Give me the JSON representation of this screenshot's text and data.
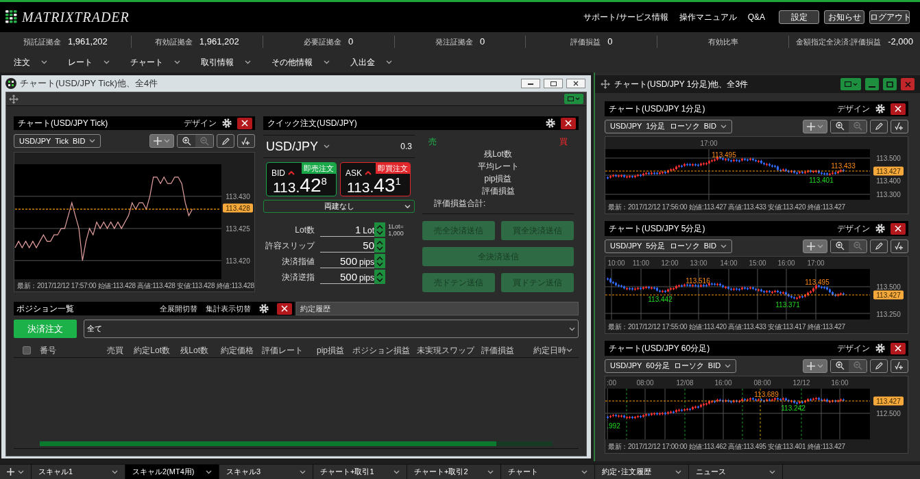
{
  "header": {
    "logo": "MATRIXTRADER",
    "links": [
      "サポート/サービス情報",
      "操作マニュアル",
      "Q&A"
    ],
    "buttons": [
      "設定",
      "お知らせ",
      "ログアウト"
    ]
  },
  "account_bar": [
    {
      "label": "預託証拠金",
      "value": "1,961,202"
    },
    {
      "label": "有効証拠金",
      "value": "1,961,202"
    },
    {
      "label": "必要証拠金",
      "value": "0"
    },
    {
      "label": "発注証拠金",
      "value": "0"
    },
    {
      "label": "評価損益",
      "value": "0"
    },
    {
      "label": "有効比率"
    },
    {
      "label": "金額指定全決済:評価損益",
      "value": "-2,000"
    }
  ],
  "menu": [
    "注文",
    "レート",
    "チャート",
    "取引情報",
    "その他情報",
    "入出金"
  ],
  "left_window": {
    "title": "チャート(USD/JPY Tick)他、全4件",
    "tick_chart": {
      "title": "チャート(USD/JPY Tick)",
      "design": "デザイン",
      "symbol": "USD/JPY  Tick  BID",
      "current_price": "113.428",
      "chart_data": {
        "type": "line",
        "grid": true,
        "ylim": [
          113.4171,
          113.435
        ],
        "yticks": [
          {
            "value": 113.43,
            "label": "113.430"
          },
          {
            "value": 113.425,
            "label": "113.425"
          },
          {
            "value": 113.42,
            "label": "113.420"
          }
        ],
        "series": [
          {
            "color": "#e6a1a1",
            "values": [
              113.422,
              113.423,
              113.422,
              113.423,
              113.422,
              113.423,
              113.422,
              113.423,
              113.424,
              113.423,
              113.423,
              113.424,
              113.424,
              113.425,
              113.425,
              113.427,
              113.429,
              113.427,
              113.425,
              113.42,
              113.423,
              113.425,
              113.424,
              113.426,
              113.425,
              113.426,
              113.425,
              113.426,
              113.425,
              113.426,
              113.425,
              113.426,
              113.427,
              113.429,
              113.428,
              113.429,
              113.429,
              113.428,
              113.43,
              113.433,
              113.433,
              113.432,
              113.433,
              113.432,
              113.432,
              113.433,
              113.433,
              113.432,
              113.429,
              113.427,
              113.428,
              null,
              null,
              null,
              null,
              null,
              null,
              null,
              null
            ]
          },
          {
            "color": "#ff9900",
            "line_style": "dashed",
            "values": [
              113.428,
              113.428,
              113.428,
              113.428,
              113.428,
              113.428,
              113.428,
              113.428,
              113.428,
              113.428,
              113.428,
              113.428,
              113.428,
              113.428,
              113.428,
              113.428,
              113.428,
              113.428,
              113.428,
              113.428,
              113.428,
              113.428,
              113.428,
              113.428,
              113.428,
              113.428,
              113.428,
              113.428,
              113.428,
              113.428,
              113.428,
              113.428,
              113.428,
              113.428,
              113.428,
              113.428,
              113.428,
              113.428,
              113.428,
              113.428,
              113.428,
              113.428,
              113.428,
              113.428,
              113.428,
              113.428,
              113.428,
              113.428,
              113.428,
              113.428,
              113.428,
              113.428,
              113.428,
              113.428,
              113.428,
              113.428,
              113.428,
              113.428,
              113.428
            ]
          }
        ]
      },
      "info": "最新：2017/12/12 17:57:00  始値:113.428  高値:113.428  安値:113.428  終値:113.428"
    },
    "quick_order": {
      "title": "クイック注文(USD/JPY)",
      "symbol": "USD/JPY",
      "spread": "0.3",
      "bid": {
        "label": "BID",
        "action": "即売注文",
        "price_main": "113.",
        "price_big": "42",
        "price_pip": "8"
      },
      "ask": {
        "label": "ASK",
        "action": "即買注文",
        "price_main": "113.",
        "price_big": "43",
        "price_pip": "1"
      },
      "hedge": "両建なし",
      "fields": [
        {
          "label": "Lot数",
          "value": "1",
          "unit": "Lot",
          "note": [
            "1Lot=",
            "1,000"
          ]
        },
        {
          "label": "許容スリップ",
          "value": "50"
        },
        {
          "label": "決済指値",
          "value": "500",
          "unit": "pips"
        },
        {
          "label": "決済逆指",
          "value": "500",
          "unit": "pips"
        }
      ],
      "sell_label": "売",
      "buy_label": "買",
      "summary": [
        "残Lot数",
        "平均レート",
        "pip損益",
        "評価損益"
      ],
      "total_label": "評価損益合計:",
      "buttons": [
        {
          "label": "売全決済送信",
          "disabled": true
        },
        {
          "label": "買全決済送信",
          "disabled": true
        },
        {
          "label": "全決済送信",
          "disabled": true
        },
        {
          "label": "売ドテン送信",
          "disabled": true
        },
        {
          "label": "買ドテン送信",
          "disabled": true
        }
      ]
    },
    "positions": {
      "title": "ポジション一覧",
      "actions": [
        "全展開切替",
        "集計表示切替"
      ],
      "tab": "約定履歴",
      "settle_button": "決済注文",
      "filter": "全て",
      "select_all_checked": false,
      "columns": [
        "番号",
        "売買",
        "約定Lot数",
        "残Lot数",
        "約定価格",
        "評価レート",
        "pip損益",
        "ポジション損益",
        "未実現スワップ",
        "評価損益",
        "約定日時"
      ]
    }
  },
  "right_window": {
    "title": "チャート(USD/JPY 1分足)他、全3件",
    "charts": [
      {
        "title": "チャート(USD/JPY 1分足)",
        "design": "デザイン",
        "symbol": "USD/JPY  1分足  ローソク  BID",
        "x_labels": [
          "17:00"
        ],
        "y_labels": [
          "113.500",
          "113.400",
          "113.300"
        ],
        "current_price": "113.427",
        "annotations": [
          {
            "text": "113.495",
            "kind": "high"
          },
          {
            "text": "113.433",
            "kind": "high"
          },
          {
            "text": "113.401",
            "kind": "low"
          }
        ],
        "info": "最新：2017/12/12 17:56:00  始値:113.427  高値:113.433  安値:113.420  終値:113.427"
      },
      {
        "title": "チャート(USD/JPY 5分足)",
        "design": "デザイン",
        "symbol": "USD/JPY  5分足  ローソク  BID",
        "x_labels": [
          "10:00",
          "11:00",
          "12:00",
          "13:00",
          "14:00",
          "15:00",
          "16:00",
          "17:00"
        ],
        "y_labels": [
          "113.500",
          "113.250"
        ],
        "current_price": "113.427",
        "annotations": [
          {
            "text": "113.516",
            "kind": "high"
          },
          {
            "text": "113.442",
            "kind": "low"
          },
          {
            "text": "113.371",
            "kind": "low"
          },
          {
            "text": "113.495",
            "kind": "high"
          }
        ],
        "info": "最新：2017/12/12 17:55:00  始値:113.420  高値:113.433  安値:113.417  終値:113.427"
      },
      {
        "title": "チャート(USD/JPY 60分足)",
        "design": "デザイン",
        "symbol": "USD/JPY  60分足  ローソク  BID",
        "x_labels": [
          ":00",
          "08:00",
          "12/08",
          "16:00",
          "08:00",
          "12/12",
          "16:00"
        ],
        "y_labels": [
          "112.500"
        ],
        "current_price": "113.427",
        "annotations": [
          {
            "text": "113.689",
            "kind": "high"
          },
          {
            "text": "113.242",
            "kind": "low"
          },
          {
            "text": ".992",
            "kind": "low"
          }
        ],
        "info": "最新：2017/12/12 17:00:00  始値:113.462  高値:113.495  安値:113.401  終値:113.427"
      }
    ]
  },
  "bottom_tabs": [
    {
      "label": "スキャル1",
      "selected": false
    },
    {
      "label": "スキャル2(MT4用)",
      "selected": true
    },
    {
      "label": "スキャル3",
      "selected": false
    },
    {
      "label": "チャート+取引1",
      "selected": false
    },
    {
      "label": "チャート+取引2",
      "selected": false
    },
    {
      "label": "チャート",
      "selected": false
    },
    {
      "label": "約定･注文履歴",
      "selected": false
    },
    {
      "label": "ニュース",
      "selected": false
    }
  ]
}
